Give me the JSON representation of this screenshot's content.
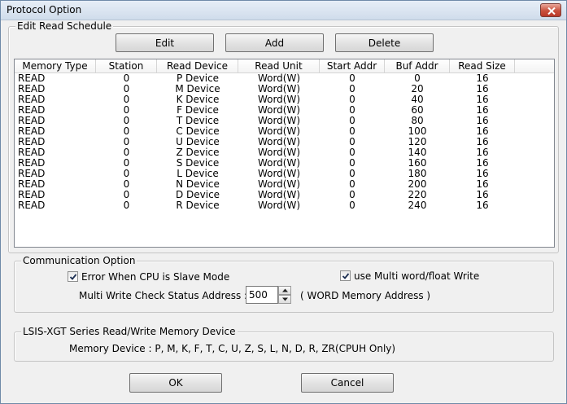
{
  "window": {
    "title": "Protocol Option"
  },
  "schedule": {
    "legend": "Edit Read Schedule",
    "buttons": {
      "edit": "Edit",
      "add": "Add",
      "delete": "Delete"
    },
    "columns": [
      "Memory Type",
      "Station",
      "Read Device",
      "Read Unit",
      "Start Addr",
      "Buf Addr",
      "Read Size"
    ],
    "rows": [
      [
        "READ",
        "0",
        "P Device",
        "Word(W)",
        "0",
        "0",
        "16"
      ],
      [
        "READ",
        "0",
        "M Device",
        "Word(W)",
        "0",
        "20",
        "16"
      ],
      [
        "READ",
        "0",
        "K Device",
        "Word(W)",
        "0",
        "40",
        "16"
      ],
      [
        "READ",
        "0",
        "F Device",
        "Word(W)",
        "0",
        "60",
        "16"
      ],
      [
        "READ",
        "0",
        "T Device",
        "Word(W)",
        "0",
        "80",
        "16"
      ],
      [
        "READ",
        "0",
        "C Device",
        "Word(W)",
        "0",
        "100",
        "16"
      ],
      [
        "READ",
        "0",
        "U Device",
        "Word(W)",
        "0",
        "120",
        "16"
      ],
      [
        "READ",
        "0",
        "Z Device",
        "Word(W)",
        "0",
        "140",
        "16"
      ],
      [
        "READ",
        "0",
        "S Device",
        "Word(W)",
        "0",
        "160",
        "16"
      ],
      [
        "READ",
        "0",
        "L Device",
        "Word(W)",
        "0",
        "180",
        "16"
      ],
      [
        "READ",
        "0",
        "N Device",
        "Word(W)",
        "0",
        "200",
        "16"
      ],
      [
        "READ",
        "0",
        "D Device",
        "Word(W)",
        "0",
        "220",
        "16"
      ],
      [
        "READ",
        "0",
        "R Device",
        "Word(W)",
        "0",
        "240",
        "16"
      ]
    ]
  },
  "communication": {
    "legend": "Communication Option",
    "error_when_cpu_slave": {
      "label": "Error When CPU is Slave Mode",
      "checked": true
    },
    "use_multi_word": {
      "label": "use Multi word/float Write",
      "checked": true
    },
    "check_status_label": "Multi Write Check Status Address :",
    "check_status_value": "500",
    "check_status_hint": "( WORD Memory Address )"
  },
  "device_info": {
    "legend": "LSIS-XGT Series Read/Write Memory Device",
    "text": "Memory Device : P,  M,  K,  F,  T,  C,  U,  Z,  S,  L,  N,  D,  R,  ZR(CPUH Only)"
  },
  "footer": {
    "ok": "OK",
    "cancel": "Cancel"
  }
}
